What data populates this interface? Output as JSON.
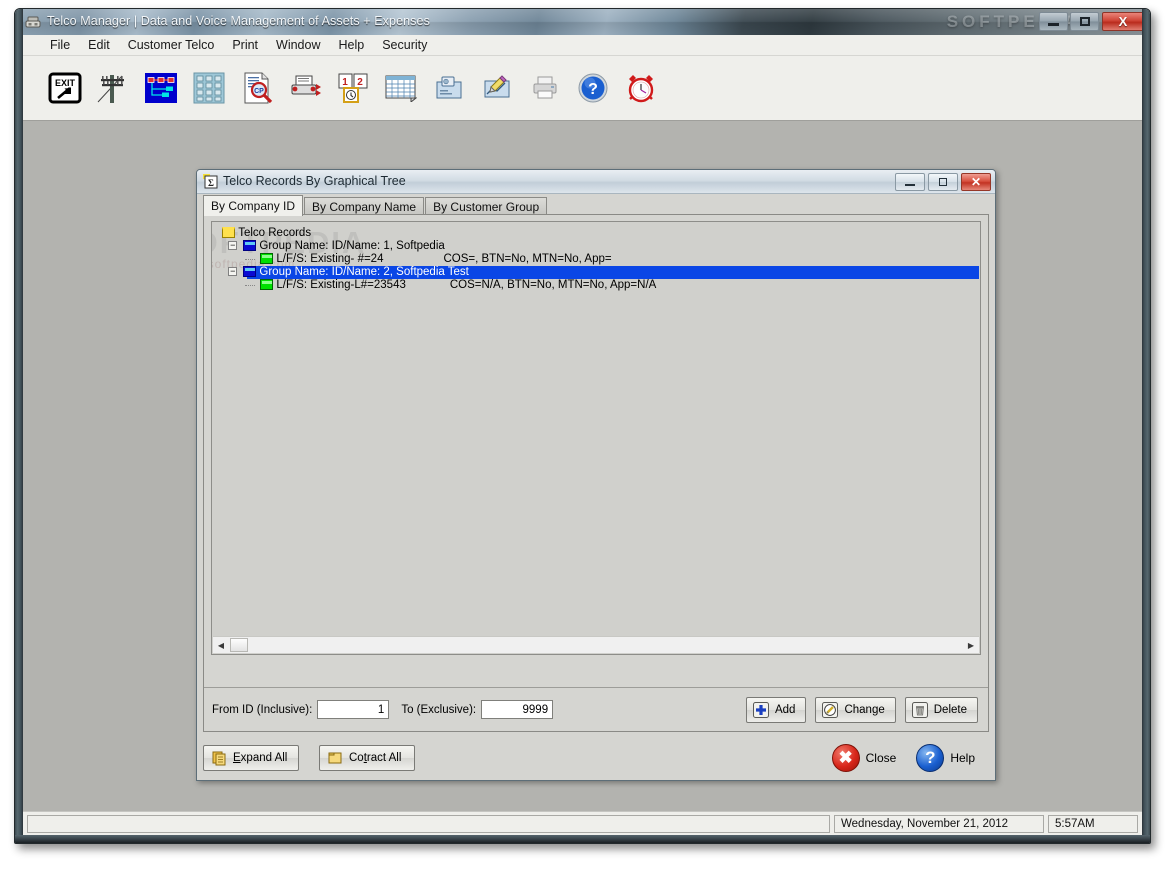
{
  "window": {
    "title": "Telco Manager | Data and Voice Management of Assets + Expenses",
    "icon": "telephone-icon",
    "watermark": "SOFTPEDIA",
    "controls": {
      "minimize": "minimize-icon",
      "maximize": "maximize-icon",
      "close": "close-icon",
      "close_glyph": "X"
    }
  },
  "menubar": {
    "items": [
      {
        "label": "File"
      },
      {
        "label": "Edit"
      },
      {
        "label": "Customer Telco"
      },
      {
        "label": "Print"
      },
      {
        "label": "Window"
      },
      {
        "label": "Help"
      },
      {
        "label": "Security"
      }
    ]
  },
  "toolbar": {
    "buttons": [
      {
        "name": "exit-icon",
        "tip": "Exit"
      },
      {
        "name": "utility-pole-icon",
        "tip": "Telco Lines"
      },
      {
        "name": "network-tree-icon",
        "tip": "Graphical Tree"
      },
      {
        "name": "keypad-icon",
        "tip": "Dial Pad"
      },
      {
        "name": "document-search-icon",
        "tip": "Find CP Record"
      },
      {
        "name": "fax-machine-icon",
        "tip": "Fax"
      },
      {
        "name": "schedule-clock-icon",
        "tip": "Schedule"
      },
      {
        "name": "spreadsheet-icon",
        "tip": "Spreadsheet"
      },
      {
        "name": "report-image-icon",
        "tip": "Reports"
      },
      {
        "name": "edit-chart-icon",
        "tip": "Edit Chart"
      },
      {
        "name": "printer-icon",
        "tip": "Print"
      },
      {
        "name": "help-icon",
        "tip": "Help"
      },
      {
        "name": "alarm-clock-icon",
        "tip": "Alarm"
      }
    ]
  },
  "child_window": {
    "title": "Telco Records By Graphical Tree",
    "icon": "tree-report-icon",
    "controls": {
      "minimize": "minimize-icon",
      "maximize": "maximize-icon",
      "close": "close-icon",
      "close_glyph": "✕"
    },
    "tabs": [
      {
        "label": "By Company ID",
        "active": true
      },
      {
        "label": "By Company Name",
        "active": false
      },
      {
        "label": "By Customer Group",
        "active": false
      }
    ],
    "watermark_big": "SOFTPEDIA",
    "watermark_small": "www.softpedia.com",
    "tree": [
      {
        "level": 0,
        "icon": "folder-icon",
        "label": "Telco Records",
        "selected": false,
        "expander": ""
      },
      {
        "level": 1,
        "icon": "group-node-icon",
        "label": "Group Name:  ID/Name: 1, Softpedia",
        "selected": false,
        "expander": "−"
      },
      {
        "level": 2,
        "icon": "record-node-icon",
        "label": "L/F/S: Existing- #=24",
        "detail": "COS=, BTN=No, MTN=No, App=",
        "selected": false,
        "expander": ""
      },
      {
        "level": 1,
        "icon": "group-node-icon",
        "label": "Group Name:  ID/Name: 2, Softpedia Test",
        "selected": true,
        "expander": "−"
      },
      {
        "level": 2,
        "icon": "record-node-icon",
        "label": "L/F/S: Existing-L#=23543",
        "detail": "COS=N/A, BTN=No, MTN=No, App=N/A",
        "selected": false,
        "expander": ""
      }
    ],
    "range": {
      "from_label": "From ID (Inclusive):",
      "from_value": "1",
      "to_label": "To (Exclusive):",
      "to_value": "9999"
    },
    "record_buttons": [
      {
        "label": "Add",
        "accel": "A",
        "icon": "plus-icon"
      },
      {
        "label": "Change",
        "accel": "C",
        "icon": "pencil-edit-icon"
      },
      {
        "label": "Delete",
        "accel": "D",
        "icon": "trash-icon"
      }
    ],
    "footer_buttons": [
      {
        "label": "Expand All",
        "accel": "E",
        "icon": "expand-folder-icon"
      },
      {
        "label": "Contract All",
        "accel": "t",
        "icon": "collapse-folder-icon"
      }
    ],
    "action_buttons": [
      {
        "label": "Close",
        "icon": "close-circle-icon",
        "glyph": "✖",
        "color": "#d8261a"
      },
      {
        "label": "Help",
        "icon": "help-circle-icon",
        "glyph": "?",
        "color": "#1a5fd0"
      }
    ]
  },
  "statusbar": {
    "message": "",
    "date": "Wednesday, November 21, 2012",
    "time": "5:57AM"
  },
  "colors": {
    "selection_blue": "#0a46e6",
    "client_gray": "#b3b3af",
    "panel_gray": "#d5d5d1",
    "tree_gray": "#d0d0cc",
    "close_red": "#c23323"
  }
}
